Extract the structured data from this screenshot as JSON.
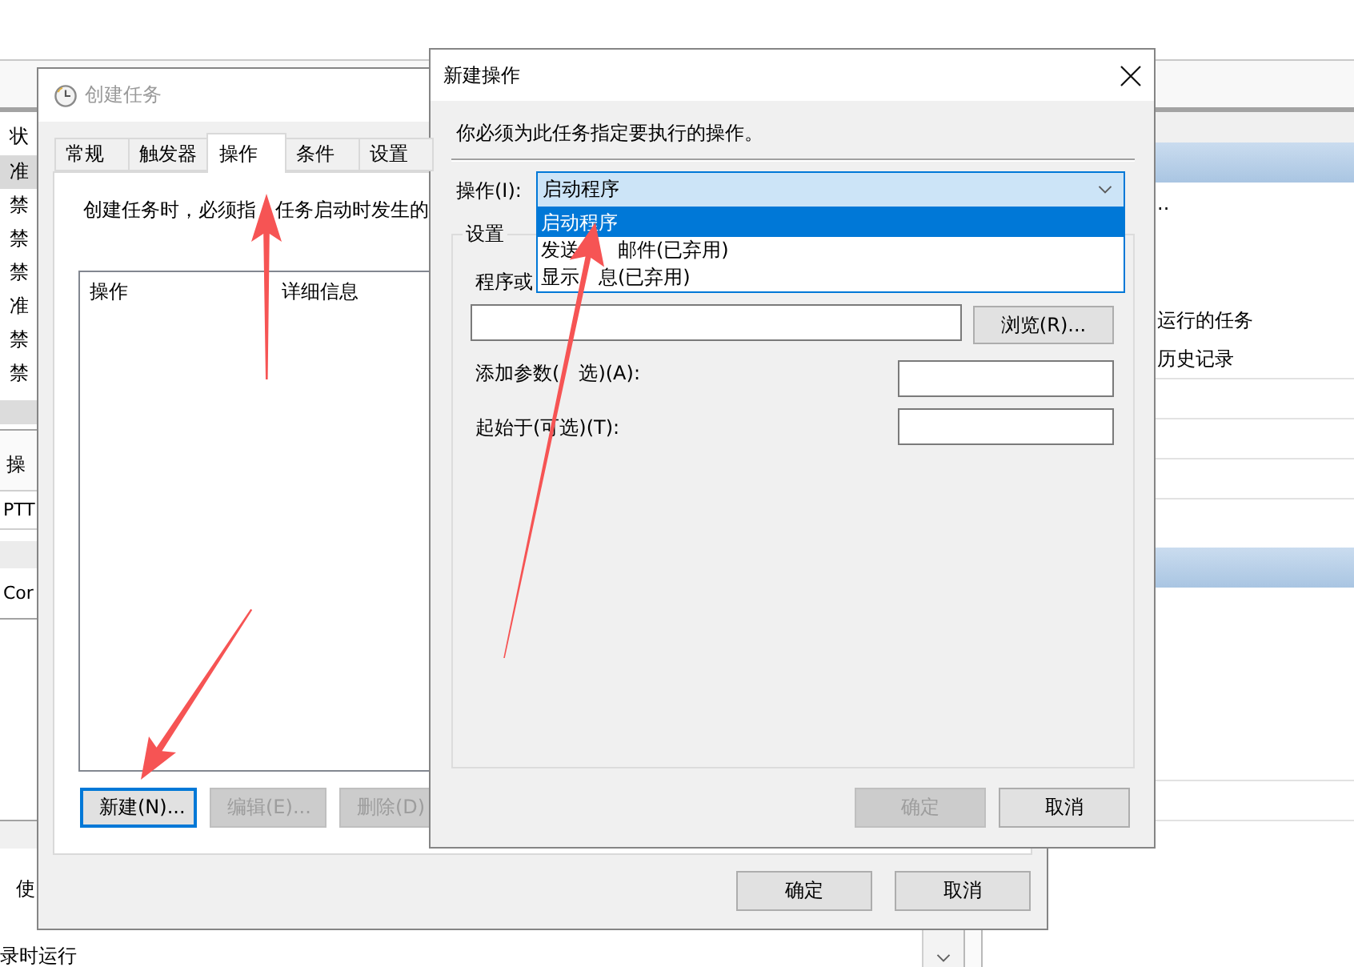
{
  "main_window": {
    "task_list": {
      "header": "状",
      "rows": [
        {
          "status": "准",
          "selected": true
        },
        {
          "status": "禁",
          "selected": false
        },
        {
          "status": "禁",
          "selected": false
        },
        {
          "status": "禁",
          "selected": false
        },
        {
          "status": "准",
          "selected": false
        },
        {
          "status": "禁",
          "selected": false
        },
        {
          "status": "禁",
          "selected": false
        }
      ]
    },
    "detail_tab": "操",
    "detail_rows": [
      "PTT",
      "Cor"
    ],
    "description_fragment": "使",
    "trigger_fragment": "录时运行",
    "actions_pane": {
      "items": [
        "..",
        "运行的任务",
        "历史记录"
      ]
    }
  },
  "create_task_dialog": {
    "title": "创建任务",
    "active": false,
    "tabs": [
      {
        "label": "常规",
        "selected": false
      },
      {
        "label": "触发器",
        "selected": false
      },
      {
        "label": "操作",
        "selected": true
      },
      {
        "label": "条件",
        "selected": false
      },
      {
        "label": "设置",
        "selected": false
      }
    ],
    "description_parts": [
      "创建任务时，必须指",
      "任务启动时发生的"
    ],
    "columns": [
      "操作",
      "详细信息"
    ],
    "buttons": [
      {
        "label": "新建(N)...",
        "disabled": false,
        "focused": true
      },
      {
        "label": "编辑(E)...",
        "disabled": true,
        "focused": false
      },
      {
        "label": "删除(D)",
        "disabled": true,
        "focused": false
      }
    ],
    "footer_buttons": [
      "确定",
      "取消"
    ]
  },
  "new_action_dialog": {
    "title": "新建操作",
    "active": true,
    "description": "你必须为此任务指定要执行的操作。",
    "action_field": {
      "label": "操作(I):",
      "value": "启动程序",
      "expanded": true,
      "options": [
        {
          "label_parts": [
            "启动程序"
          ],
          "selected": true
        },
        {
          "label_parts": [
            "发送",
            "邮件(已弃用)"
          ],
          "selected": false
        },
        {
          "label_parts": [
            "显示",
            "息(已弃用)"
          ],
          "selected": false
        }
      ]
    },
    "settings_group": {
      "title": "设置",
      "program_label": "程序或",
      "browse_button": "浏览(R)...",
      "arguments_label_parts": [
        "添加参数(",
        "选)(A):"
      ],
      "start_in_label": "起始于(可选)(T):"
    },
    "buttons": [
      {
        "label": "确定",
        "disabled": true
      },
      {
        "label": "取消",
        "disabled": false
      }
    ]
  }
}
